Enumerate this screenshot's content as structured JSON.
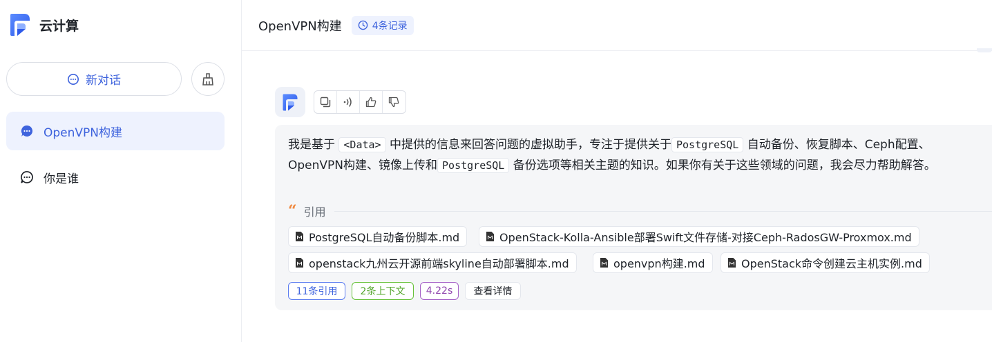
{
  "app": {
    "name": "云计算"
  },
  "sidebar": {
    "new_chat_label": "新对话",
    "conversations": [
      {
        "label": "OpenVPN构建",
        "active": true
      },
      {
        "label": "你是谁",
        "active": false
      }
    ]
  },
  "header": {
    "title": "OpenVPN构建",
    "record_badge": "4条记录"
  },
  "message": {
    "parts": {
      "p1": "我是基于",
      "c1": "<Data>",
      "p2": "中提供的信息来回答问题的虚拟助手，专注于提供关于",
      "c2": "PostgreSQL",
      "p3": "自动备份、恢复脚本、Ceph配置、OpenVPN构建、镜像上传和",
      "c3": "PostgreSQL",
      "p4": "备份选项等相关主题的知识。如果你有关于这些领域的问题，我会尽力帮助解答。"
    },
    "citation_label": "引用",
    "citations": [
      "PostgreSQL自动备份脚本.md",
      "OpenStack-Kolla-Ansible部署Swift文件存储-对接Ceph-RadosGW-Proxmox.md",
      "openstack九州云开源前端skyline自动部署脚本.md",
      "openvpn构建.md",
      "OpenStack命令创建云主机实例.md"
    ],
    "tags": {
      "references": "11条引用",
      "context": "2条上下文",
      "time": "4.22s",
      "details": "查看详情"
    }
  },
  "colors": {
    "accent": "#3e63dd",
    "quote": "#f0883e",
    "green": "#67c23a",
    "purple": "#a45fc6"
  },
  "icons": [
    "logo-icon",
    "chat-bubble-icon",
    "broom-icon",
    "clock-icon",
    "copy-icon",
    "speaker-icon",
    "thumbs-up-icon",
    "thumbs-down-icon",
    "quote-icon",
    "markdown-file-icon"
  ]
}
